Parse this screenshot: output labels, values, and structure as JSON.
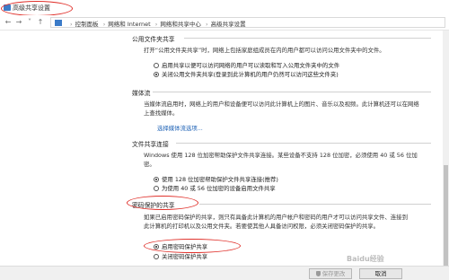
{
  "window": {
    "title": "高级共享设置"
  },
  "address": {
    "crumbs": [
      "控制面板",
      "网络和 Internet",
      "网络和共享中心",
      "高级共享设置"
    ]
  },
  "public_folder": {
    "title": "公用文件夹共享",
    "desc": "打开“公用文件夹共享”时，网络上包括家庭组成员在内的用户都可以访问公用文件夹中的文件。",
    "options": [
      {
        "label": "启用共享以便可以访问网络的用户可以读取和写入公用文件夹中的文件",
        "selected": false
      },
      {
        "label": "关闭公用文件夹共享(登录到此计算机的用户仍然可以访问这些文件夹)",
        "selected": true
      }
    ]
  },
  "media": {
    "title": "媒体流",
    "desc": "当媒体流启用时，网络上的用户和设备便可以访问此计算机上的图片、音乐以及视频。此计算机还可以在网络上查找媒体。",
    "link": "选择媒体流选项..."
  },
  "file_sharing": {
    "title": "文件共享连接",
    "desc": "Windows 使用 128 位加密帮助保护文件共享连接。某些设备不支持 128 位加密，必须使用 40 或 56 位加密。",
    "options": [
      {
        "label": "使用 128 位加密帮助保护文件共享连接(推荐)",
        "selected": true
      },
      {
        "label": "为使用 40 或 56 位加密的设备启用文件共享",
        "selected": false
      }
    ]
  },
  "password": {
    "title": "密码保护的共享",
    "desc": "如果已启用密码保护的共享，则只有具备此计算机的用户帐户和密码的用户才可以访问共享文件、连接到此计算机的打印机以及公用文件夹。若要使其他人具备访问权限，必须关闭密码保护的共享。",
    "options": [
      {
        "label": "启用密码保护共享",
        "selected": true
      },
      {
        "label": "关闭密码保护共享",
        "selected": false
      }
    ]
  },
  "footer": {
    "save_label": "保存更改",
    "cancel_label": "取消"
  },
  "watermark": "Baidu经验",
  "colors": {
    "annotation": "#e0302a",
    "link": "#1a5fb4"
  }
}
